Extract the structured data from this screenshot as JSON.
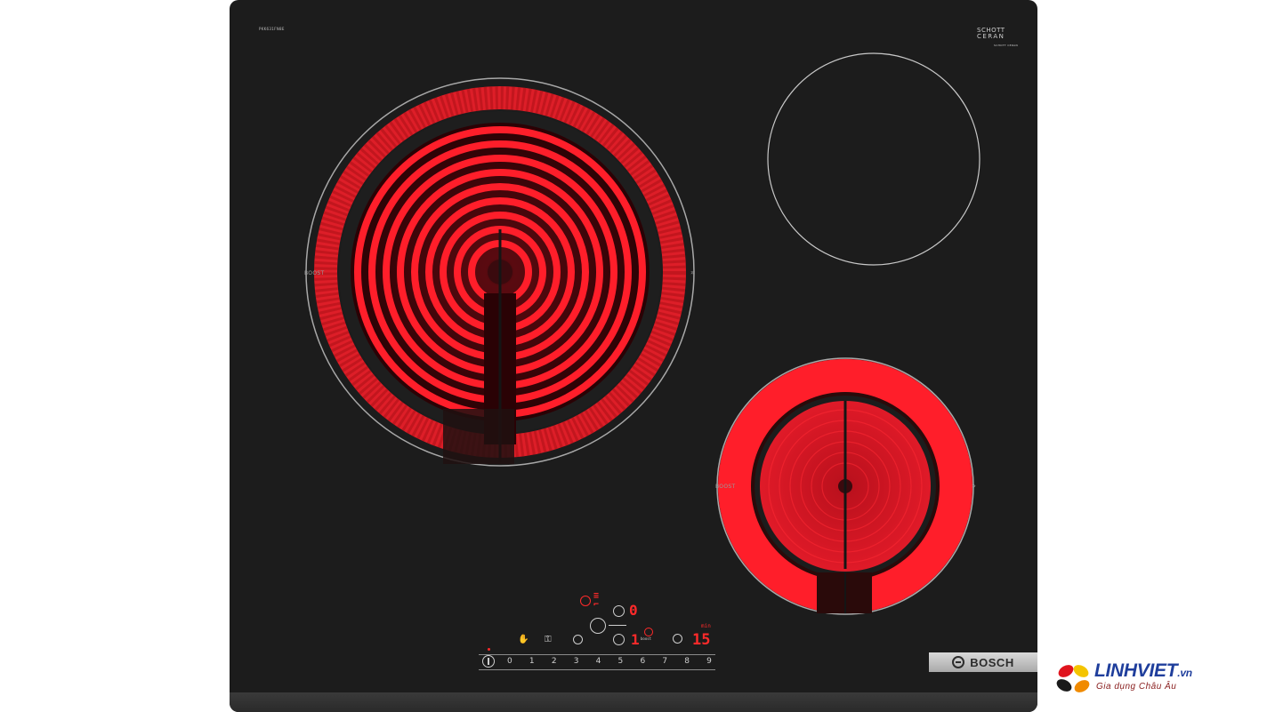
{
  "product": {
    "model_code": "PKK631FN8E",
    "glass_brand_line1": "SCHOTT",
    "glass_brand_line2": "CERAN",
    "glass_small_text": "SCHOTT CERAN",
    "brand": "BOSCH"
  },
  "zones": {
    "large_left": {
      "boost_label": "BOOST",
      "state": "on"
    },
    "top_right": {
      "state": "off"
    },
    "bottom_right": {
      "boost_label": "BOOST",
      "state": "on"
    }
  },
  "controls": {
    "display_top": "0",
    "display_mid": "1",
    "timer_display": "15",
    "timer_unit": "min",
    "boost_small": "boost",
    "scale": [
      "0",
      "1",
      "2",
      "3",
      "4",
      "5",
      "6",
      "7",
      "8",
      "9"
    ]
  },
  "watermark": {
    "name": "LINHVIET",
    "suffix": ".vn",
    "tagline": "Gia dụng Châu Âu"
  },
  "colors": {
    "glass": "#1c1c1c",
    "heat": "#ff1e2a",
    "ring_line": "#a8a8a8"
  }
}
